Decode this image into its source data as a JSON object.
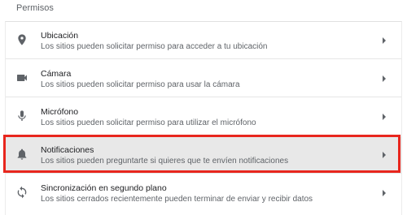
{
  "section": {
    "title": "Permisos"
  },
  "colors": {
    "highlight": "#e8261d",
    "selected_row": "#e8e8e8",
    "icon": "#5f6368"
  },
  "permissions": [
    {
      "icon": "location-pin-icon",
      "title": "Ubicación",
      "description": "Los sitios pueden solicitar permiso para acceder a tu ubicación"
    },
    {
      "icon": "camera-icon",
      "title": "Cámara",
      "description": "Los sitios pueden solicitar permiso para usar la cámara"
    },
    {
      "icon": "microphone-icon",
      "title": "Micrófono",
      "description": "Los sitios pueden solicitar permiso para utilizar el micrófono"
    },
    {
      "icon": "bell-icon",
      "title": "Notificaciones",
      "description": "Los sitios pueden preguntarte si quieres que te envíen notificaciones",
      "highlighted": true
    },
    {
      "icon": "sync-icon",
      "title": "Sincronización en segundo plano",
      "description": "Los sitios cerrados recientemente pueden terminar de enviar y recibir datos"
    }
  ]
}
